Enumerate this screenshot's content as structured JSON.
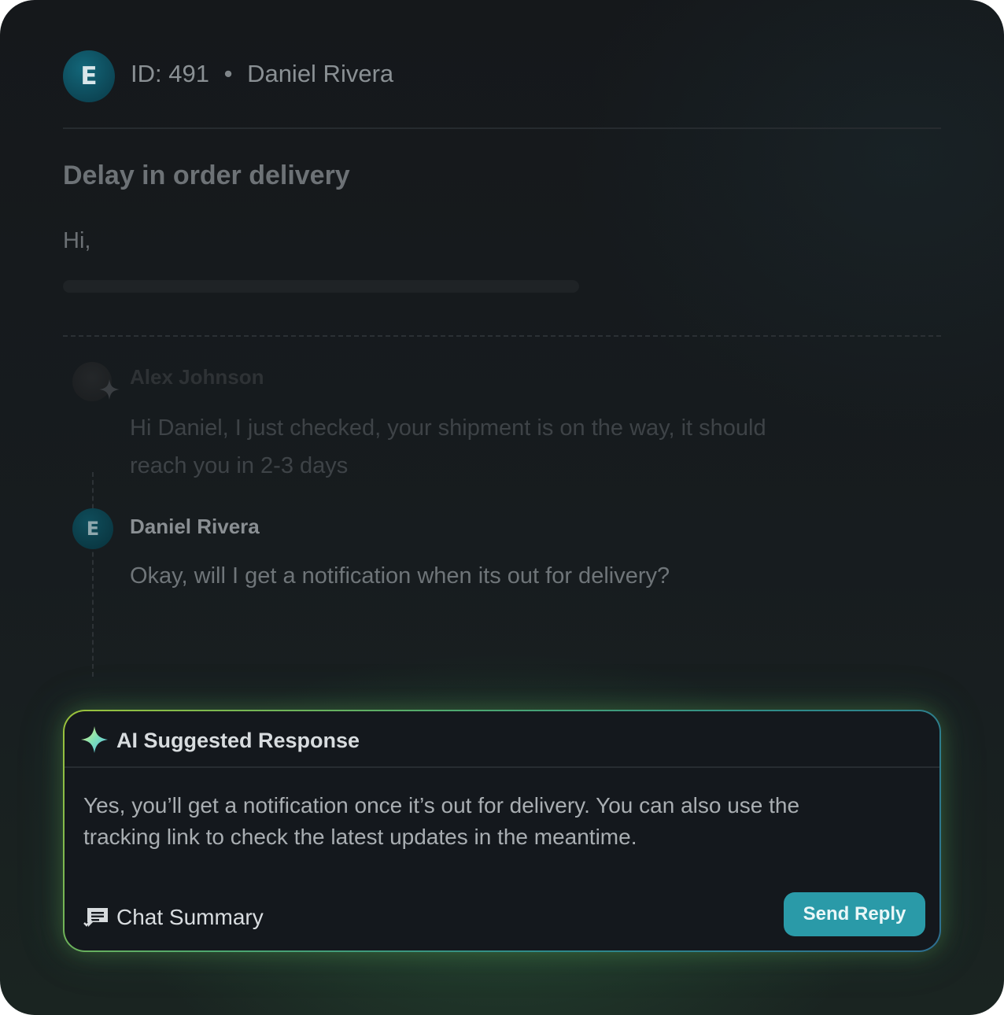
{
  "ticket": {
    "avatar_initial": "E",
    "id_label": "ID: 491",
    "separator": "•",
    "customer_name": "Daniel Rivera",
    "subject": "Delay in order delivery",
    "greeting": "Hi,"
  },
  "thread": [
    {
      "author": "Alex Johnson",
      "text": "Hi Daniel, I just checked, your shipment is on the way, it should reach you in 2-3 days"
    },
    {
      "avatar_initial": "E",
      "author": "Daniel Rivera",
      "text": "Okay, will I get a notification when its out for delivery?"
    }
  ],
  "ai_panel": {
    "title": "AI Suggested Response",
    "body": "Yes, you’ll get a notification once it’s out for delivery. You can also use the tracking link to check the latest updates in the meantime.",
    "chat_summary_label": "Chat Summary",
    "send_label": "Send Reply"
  },
  "colors": {
    "accent_teal": "#2a9aa8",
    "glow_green": "#9cc23a",
    "avatar_teal": "#13677a"
  },
  "icons": {
    "sparkle": "sparkle-icon",
    "chat_summary": "chat-summary-icon"
  }
}
